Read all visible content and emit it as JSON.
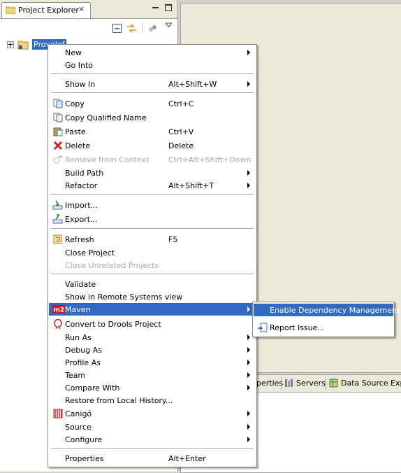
{
  "project_explorer": {
    "tab_title": "Project Explorer",
    "close_glyph": "✕",
    "tree": {
      "project_label": "ProvaJef"
    }
  },
  "bottom_panel": {
    "tabs": [
      "perties",
      "Servers",
      "Data Source Explo"
    ]
  },
  "context_menu": {
    "items": [
      {
        "label": "New",
        "icon": "",
        "shortcut": "",
        "submenu": true
      },
      {
        "label": "Go Into",
        "icon": "",
        "shortcut": "",
        "submenu": false
      },
      {
        "label": "Show In",
        "icon": "",
        "shortcut": "Alt+Shift+W",
        "submenu": true
      },
      {
        "label": "Copy",
        "icon": "copy-icon",
        "shortcut": "Ctrl+C",
        "submenu": false
      },
      {
        "label": "Copy Qualified Name",
        "icon": "copy-qualified-name-icon",
        "shortcut": "",
        "submenu": false
      },
      {
        "label": "Paste",
        "icon": "paste-icon",
        "shortcut": "Ctrl+V",
        "submenu": false
      },
      {
        "label": "Delete",
        "icon": "delete-icon",
        "shortcut": "Delete",
        "submenu": false
      },
      {
        "label": "Remove from Context",
        "icon": "remove-from-context-icon",
        "shortcut": "Ctrl+Alt+Shift+Down",
        "submenu": false,
        "disabled": true
      },
      {
        "label": "Build Path",
        "icon": "",
        "shortcut": "",
        "submenu": true
      },
      {
        "label": "Refactor",
        "icon": "",
        "shortcut": "Alt+Shift+T",
        "submenu": true
      },
      {
        "label": "Import...",
        "icon": "import-icon",
        "shortcut": "",
        "submenu": false
      },
      {
        "label": "Export...",
        "icon": "export-icon",
        "shortcut": "",
        "submenu": false
      },
      {
        "label": "Refresh",
        "icon": "refresh-icon",
        "shortcut": "F5",
        "submenu": false
      },
      {
        "label": "Close Project",
        "icon": "",
        "shortcut": "",
        "submenu": false
      },
      {
        "label": "Close Unrelated Projects",
        "icon": "",
        "shortcut": "",
        "submenu": false,
        "disabled": true
      },
      {
        "label": "Validate",
        "icon": "",
        "shortcut": "",
        "submenu": false
      },
      {
        "label": "Show in Remote Systems view",
        "icon": "",
        "shortcut": "",
        "submenu": false
      },
      {
        "label": "Maven",
        "icon": "m2-icon",
        "shortcut": "",
        "submenu": true,
        "highlighted": true
      },
      {
        "label": "Convert to Drools Project",
        "icon": "drools-icon",
        "shortcut": "",
        "submenu": false
      },
      {
        "label": "Run As",
        "icon": "",
        "shortcut": "",
        "submenu": true
      },
      {
        "label": "Debug As",
        "icon": "",
        "shortcut": "",
        "submenu": true
      },
      {
        "label": "Profile As",
        "icon": "",
        "shortcut": "",
        "submenu": true
      },
      {
        "label": "Team",
        "icon": "",
        "shortcut": "",
        "submenu": true
      },
      {
        "label": "Compare With",
        "icon": "",
        "shortcut": "",
        "submenu": true
      },
      {
        "label": "Restore from Local History...",
        "icon": "",
        "shortcut": "",
        "submenu": false
      },
      {
        "label": "Canigó",
        "icon": "canigo-icon",
        "shortcut": "",
        "submenu": true
      },
      {
        "label": "Source",
        "icon": "",
        "shortcut": "",
        "submenu": true
      },
      {
        "label": "Configure",
        "icon": "",
        "shortcut": "",
        "submenu": true
      },
      {
        "label": "Properties",
        "icon": "",
        "shortcut": "Alt+Enter",
        "submenu": false
      }
    ]
  },
  "maven_submenu": {
    "items": [
      {
        "label": "Enable Dependency Management",
        "icon": "",
        "highlighted": true
      },
      {
        "label": "Report Issue...",
        "icon": "report-issue-icon",
        "highlighted": false
      }
    ]
  },
  "colors": {
    "selection": "#316ac5",
    "menu_background": "#ffffff",
    "chrome": "#ece9d8",
    "disabled_text": "#a9a9a9"
  }
}
